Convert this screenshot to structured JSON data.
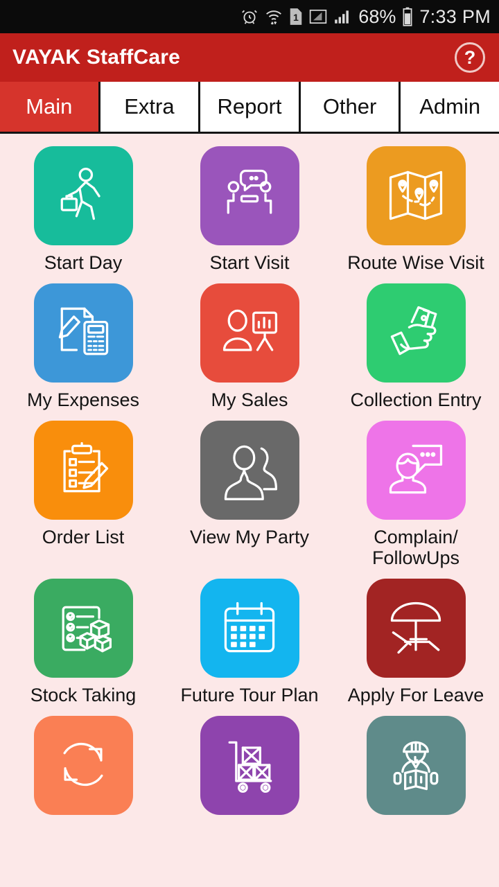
{
  "statusbar": {
    "icons": [
      "alarm-icon",
      "wifi-icon",
      "sim-1-icon",
      "signal-empty-icon",
      "signal-full-icon"
    ],
    "sim_label": "1",
    "battery_percent": "68%",
    "clock": "7:33 PM"
  },
  "titlebar": {
    "title": "VAYAK StaffCare",
    "help_label": "?",
    "bg_color": "#c0201c"
  },
  "tabs": [
    {
      "label": "Main",
      "active": true
    },
    {
      "label": "Extra",
      "active": false
    },
    {
      "label": "Report",
      "active": false
    },
    {
      "label": "Other",
      "active": false
    },
    {
      "label": "Admin",
      "active": false
    }
  ],
  "grid": {
    "background_color": "#fce8e8",
    "items": [
      {
        "label": "Start Day",
        "icon": "walking-person-briefcase-icon",
        "color": "#17bc9b"
      },
      {
        "label": "Start Visit",
        "icon": "meeting-people-chat-icon",
        "color": "#9a55bb"
      },
      {
        "label": "Route Wise Visit",
        "icon": "folded-map-pins-icon",
        "color": "#ec9b20"
      },
      {
        "label": "My Expenses",
        "icon": "document-pencil-calculator-icon",
        "color": "#3d97d8"
      },
      {
        "label": "My Sales",
        "icon": "person-chart-board-icon",
        "color": "#e74c3c"
      },
      {
        "label": "Collection Entry",
        "icon": "hand-money-icon",
        "color": "#2ecc71"
      },
      {
        "label": "Order List",
        "icon": "clipboard-pencil-icon",
        "color": "#f98e0c"
      },
      {
        "label": "View My Party",
        "icon": "two-people-silhouette-icon",
        "color": "#696969"
      },
      {
        "label": "Complain/\nFollowUps",
        "icon": "person-speech-bubble-icon",
        "color": "#ee74e8"
      },
      {
        "label": "Stock Taking",
        "icon": "checklist-boxes-icon",
        "color": "#3aab61"
      },
      {
        "label": "Future Tour Plan",
        "icon": "calendar-icon",
        "color": "#13b5ef"
      },
      {
        "label": "Apply For Leave",
        "icon": "beach-umbrella-chair-icon",
        "color": "#a22423"
      },
      {
        "label": "",
        "icon": "sync-refresh-icon",
        "color": "#fa7f54"
      },
      {
        "label": "",
        "icon": "hand-truck-boxes-icon",
        "color": "#8e44ad"
      },
      {
        "label": "",
        "icon": "worker-reading-map-icon",
        "color": "#5f8b8a"
      }
    ]
  }
}
